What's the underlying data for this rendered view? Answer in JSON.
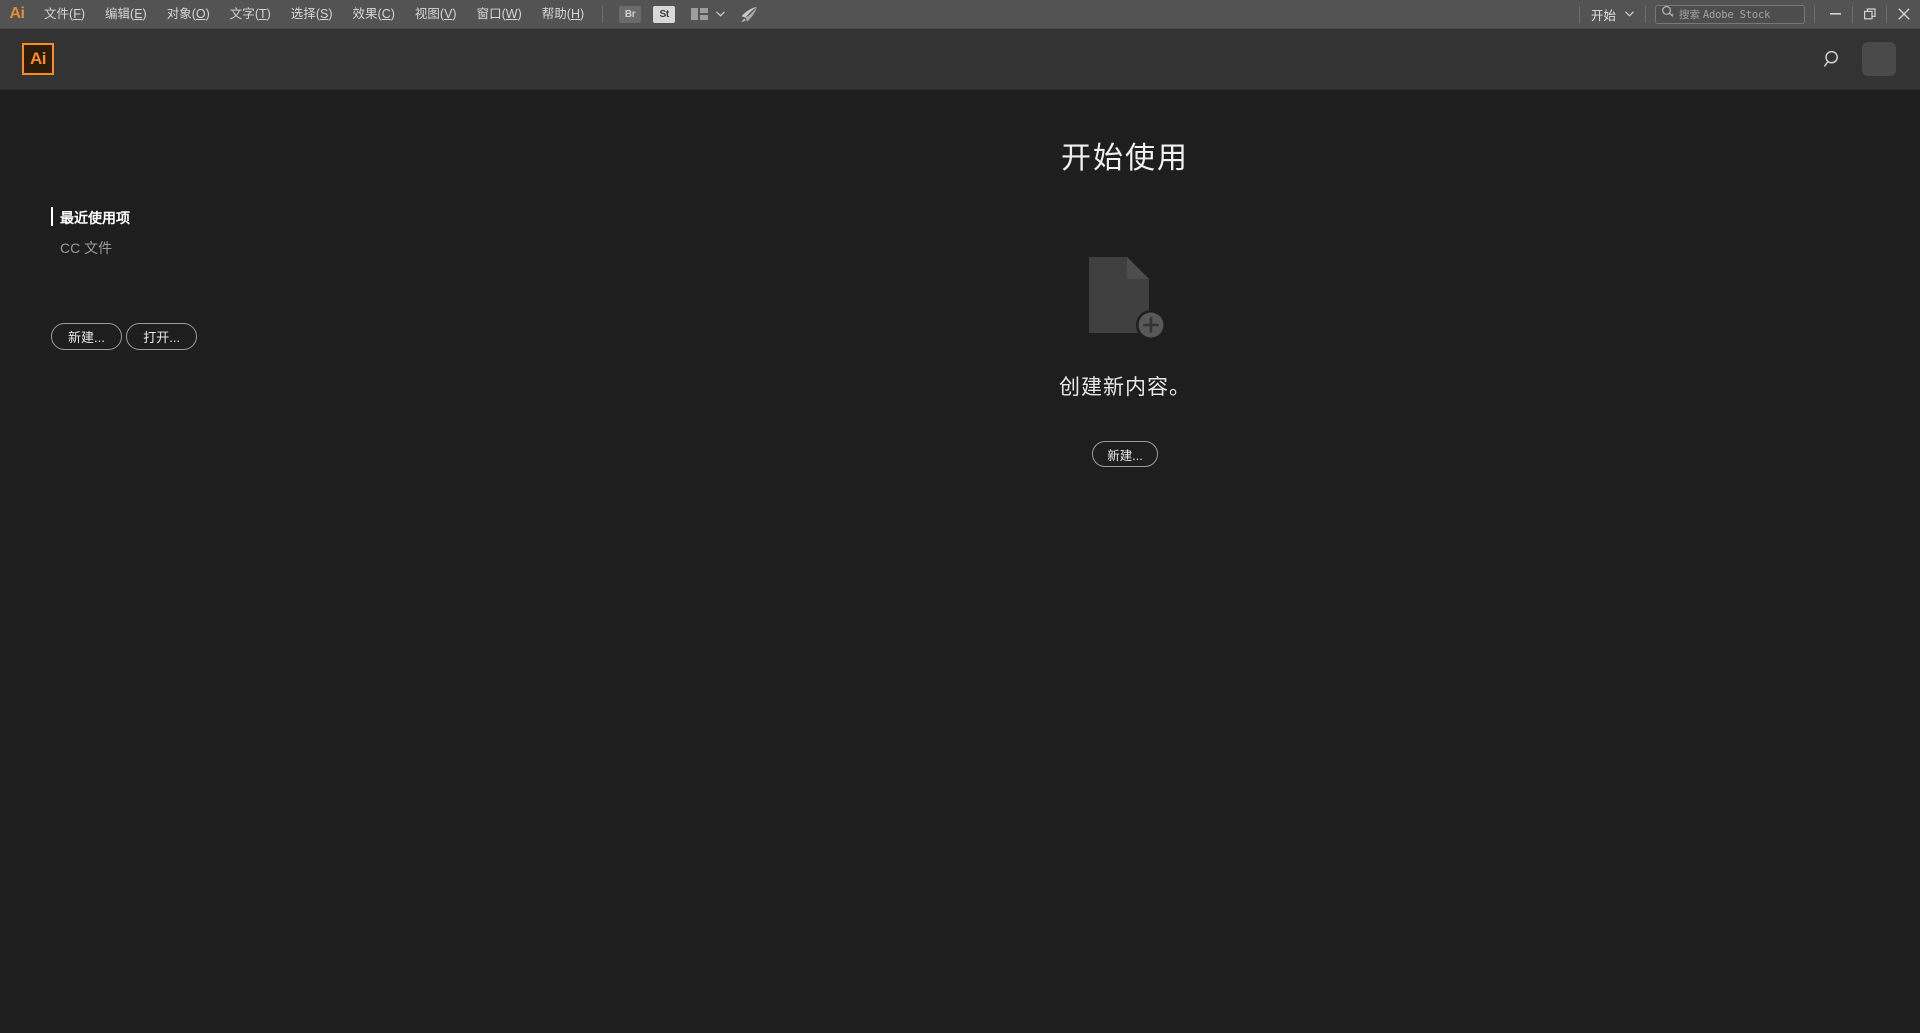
{
  "menubar": {
    "app_mark": "Ai",
    "items": [
      {
        "label": "文件",
        "accel": "F"
      },
      {
        "label": "编辑",
        "accel": "E"
      },
      {
        "label": "对象",
        "accel": "O"
      },
      {
        "label": "文字",
        "accel": "T"
      },
      {
        "label": "选择",
        "accel": "S"
      },
      {
        "label": "效果",
        "accel": "C"
      },
      {
        "label": "视图",
        "accel": "V"
      },
      {
        "label": "窗口",
        "accel": "W"
      },
      {
        "label": "帮助",
        "accel": "H"
      }
    ],
    "tools": {
      "bridge_label": "Br",
      "stock_label": "St",
      "arrange_icon": "arrange-documents-icon",
      "arrange_chevron": "▼",
      "rocket_icon": "rocket-icon"
    },
    "workspace": {
      "label": "开始",
      "chevron": "▼"
    },
    "stock_search": {
      "icon": "search-icon",
      "placeholder_cn": "搜索",
      "placeholder_en": "Adobe Stock"
    },
    "window_controls": {
      "minimize": "minimize-icon",
      "restore": "restore-icon",
      "close": "close-icon"
    }
  },
  "appbar": {
    "logo_label": "Ai",
    "search_icon": "search-icon",
    "avatar": "user-avatar"
  },
  "sidebar": {
    "links": [
      {
        "label": "最近使用项",
        "active": true
      },
      {
        "label": "CC 文件",
        "active": false
      }
    ],
    "buttons": [
      {
        "label": "新建..."
      },
      {
        "label": "打开..."
      }
    ]
  },
  "main": {
    "title": "开始使用",
    "empty_state": {
      "icon": "new-document-icon",
      "badge_icon": "plus-circle-icon",
      "text": "创建新内容。",
      "button_label": "新建..."
    }
  },
  "colors": {
    "menubar_bg": "#535353",
    "appbar_bg": "#333333",
    "content_bg": "#1e1e1e",
    "accent_orange": "#ff8a1e",
    "text_primary": "#f0f0f0",
    "text_muted": "#9a9a9a",
    "doc_icon_gray": "#3f3f3f"
  }
}
